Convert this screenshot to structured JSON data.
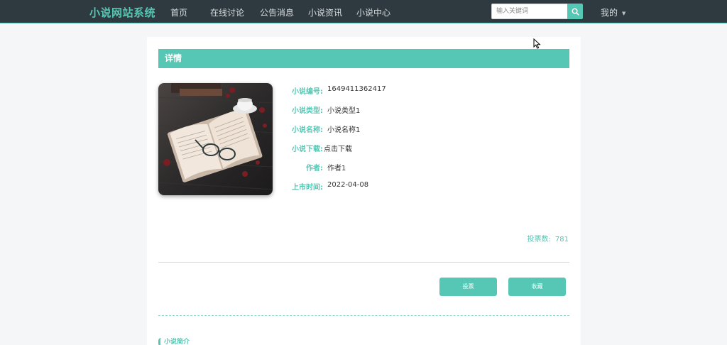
{
  "nav": {
    "brand": "小说网站系统",
    "items": [
      "首页",
      "在线讨论",
      "公告消息",
      "小说资讯",
      "小说中心"
    ],
    "search_placeholder": "输入关键词",
    "user_menu": "我的"
  },
  "detail": {
    "header": "详情",
    "fields": [
      {
        "label": "小说编号:",
        "value": "1649411362417"
      },
      {
        "label": "小说类型:",
        "value": "小说类型1"
      },
      {
        "label": "小说名称:",
        "value": "小说名称1"
      },
      {
        "label": "小说下载:",
        "value": "点击下载"
      },
      {
        "label": "作者:",
        "value": "作者1"
      },
      {
        "label": "上市时间:",
        "value": "2022-04-08"
      }
    ],
    "votes_label": "投票数:",
    "votes_value": "781",
    "vote_button": "投票",
    "favorite_button": "收藏"
  },
  "intro": {
    "title": "小说简介"
  },
  "colors": {
    "accent": "#55c7b4",
    "nav_bg": "#2f3a40"
  }
}
